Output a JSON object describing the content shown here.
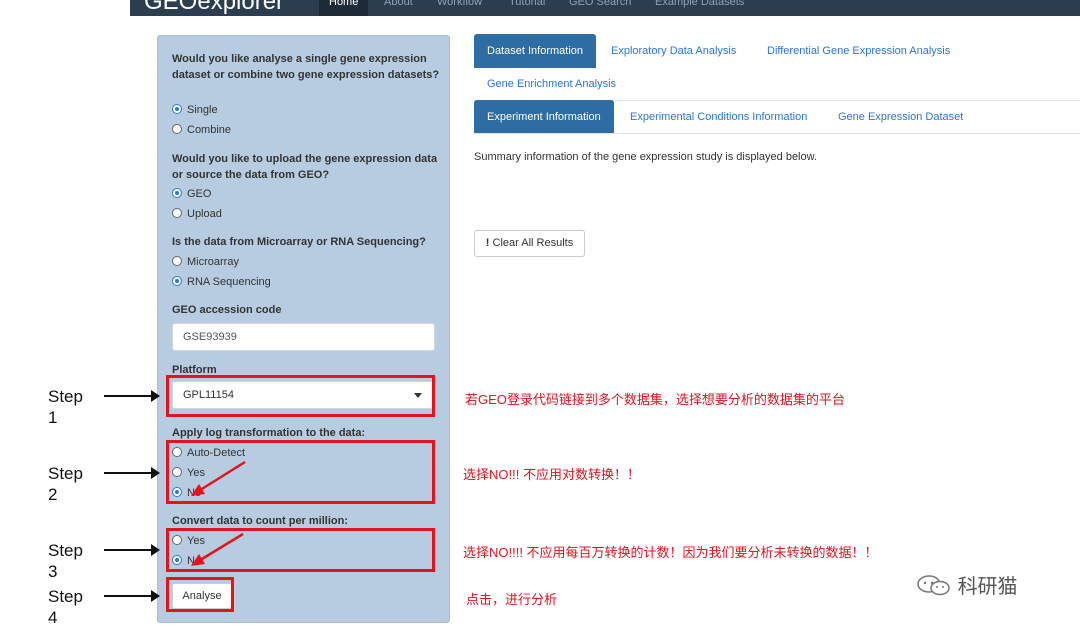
{
  "navbar": {
    "brand": "GEOexplorer",
    "items": [
      {
        "label": "Home"
      },
      {
        "label": "About"
      },
      {
        "label": "Workflow"
      },
      {
        "label": "Tutorial"
      },
      {
        "label": "GEO Search"
      },
      {
        "label": "Example Datasets"
      }
    ]
  },
  "sidebar": {
    "q1": "Would you like analyse a single gene expression dataset or combine two gene expression datasets?",
    "q1_options": [
      "Single",
      "Combine"
    ],
    "q2": "Would you like to upload the gene expression data or source the data from GEO?",
    "q2_options": [
      "GEO",
      "Upload"
    ],
    "q3": "Is the data from Microarray or RNA Sequencing?",
    "q3_options": [
      "Microarray",
      "RNA Sequencing"
    ],
    "accession_label": "GEO accession code",
    "accession_value": "GSE93939",
    "platform_label": "Platform",
    "platform_value": "GPL11154",
    "log_label": "Apply log transformation to the data:",
    "log_options": [
      "Auto-Detect",
      "Yes",
      "No"
    ],
    "cpm_label": "Convert data to count per million:",
    "cpm_options": [
      "Yes",
      "No"
    ],
    "analyse_label": "Analyse"
  },
  "steps": [
    {
      "word": "Step",
      "num": "1"
    },
    {
      "word": "Step",
      "num": "2"
    },
    {
      "word": "Step",
      "num": "3"
    },
    {
      "word": "Step",
      "num": "4"
    }
  ],
  "notes": [
    "若GEO登录代码链接到多个数据集，选择想要分析的数据集的平台",
    "选择NO!!! 不应用对数转换！！",
    "选择NO!!!! 不应用每百万转换的计数！因为我们要分析未转换的数据！！",
    "点击，进行分析"
  ],
  "main": {
    "tabs": [
      "Dataset Information",
      "Exploratory Data Analysis",
      "Differential Gene Expression Analysis",
      "Gene Enrichment Analysis"
    ],
    "subtabs": [
      "Experiment Information",
      "Experimental Conditions Information",
      "Gene Expression Dataset"
    ],
    "summary": "Summary information of the gene expression study is displayed below.",
    "clear_icon": "!",
    "clear_label": "Clear All Results"
  },
  "watermark": "科研猫",
  "colors": {
    "accent": "#2e6da4",
    "highlight": "#e3141c",
    "sidebar": "#b7cce0",
    "navbar": "#2b3e50"
  }
}
